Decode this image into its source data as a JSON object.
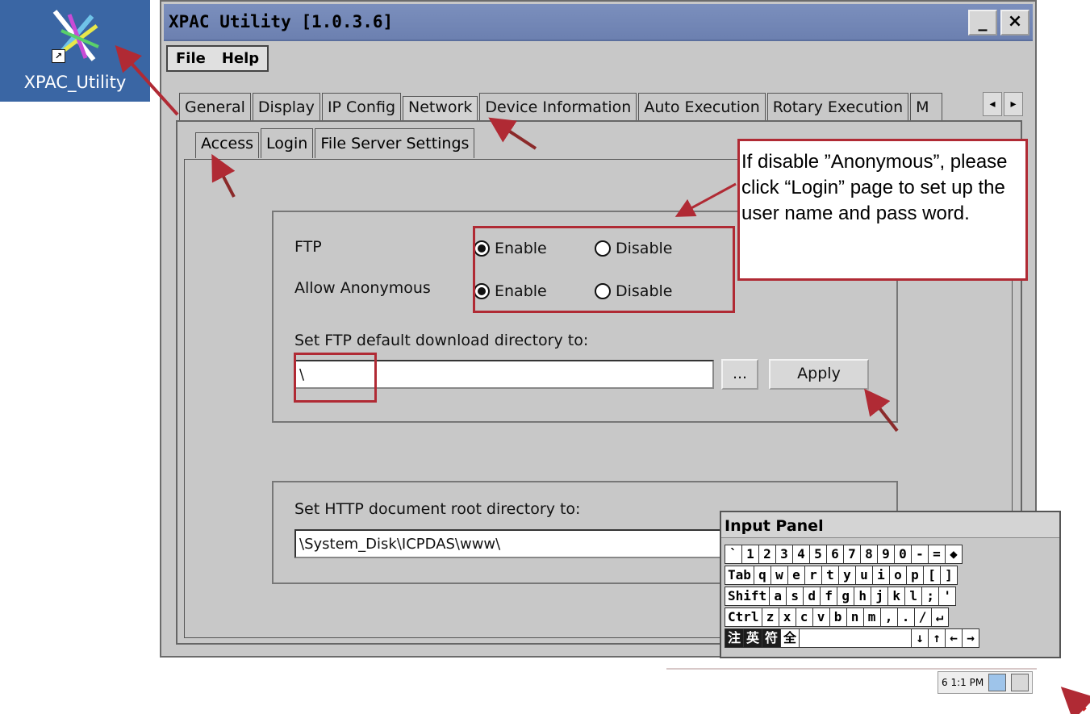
{
  "desktop": {
    "shortcut_label": "XPAC_Utility",
    "shortcut_glyph": "↗"
  },
  "window": {
    "title": "XPAC Utility  [1.0.3.6]",
    "minimize_glyph": "_",
    "close_glyph": "×",
    "menu": [
      "File",
      "Help"
    ]
  },
  "tabs": [
    "General",
    "Display",
    "IP Config",
    "Network",
    "Device Information",
    "Auto Execution",
    "Rotary Execution",
    "M"
  ],
  "tab_scroll": {
    "left": "◂",
    "right": "▸"
  },
  "subtabs": [
    "Access",
    "Login",
    "File Server Settings"
  ],
  "ftp": {
    "ftp_label": "FTP",
    "anon_label": "Allow Anonymous",
    "enable_label": "Enable",
    "disable_label": "Disable",
    "ftp_selected": "Enable",
    "anon_selected": "Enable",
    "dir_label": "Set FTP default download directory to:",
    "dir_value": "\\",
    "browse_label": "...",
    "apply_label": "Apply"
  },
  "http": {
    "root_label": "Set HTTP document root directory to:",
    "root_value": "\\System_Disk\\ICPDAS\\www\\"
  },
  "callout": {
    "text": "If disable ”Anonymous”, please click “Login” page to set up the user name and pass word."
  },
  "input_panel": {
    "title": "Input Panel",
    "rows": [
      [
        "`",
        "1",
        "2",
        "3",
        "4",
        "5",
        "6",
        "7",
        "8",
        "9",
        "0",
        "-",
        "=",
        "◆"
      ],
      [
        "Tab",
        "q",
        "w",
        "e",
        "r",
        "t",
        "y",
        "u",
        "i",
        "o",
        "p",
        "[",
        "]"
      ],
      [
        "Shift",
        "a",
        "s",
        "d",
        "f",
        "g",
        "h",
        "j",
        "k",
        "l",
        ";",
        "'"
      ],
      [
        "Ctrl",
        "z",
        "x",
        "c",
        "v",
        "b",
        "n",
        "m",
        ",",
        ".",
        "/",
        "↵"
      ],
      [
        "注",
        "英",
        "符",
        "全",
        " ",
        "↓",
        "↑",
        "←",
        "→"
      ]
    ]
  },
  "tray": {
    "time": "6 1:1 PM"
  },
  "colors": {
    "desktop_bg": "#3a66a4",
    "titlebar": "#7b8fbd",
    "window_bg": "#c8c8c8",
    "annotation_red": "#b02a34"
  }
}
